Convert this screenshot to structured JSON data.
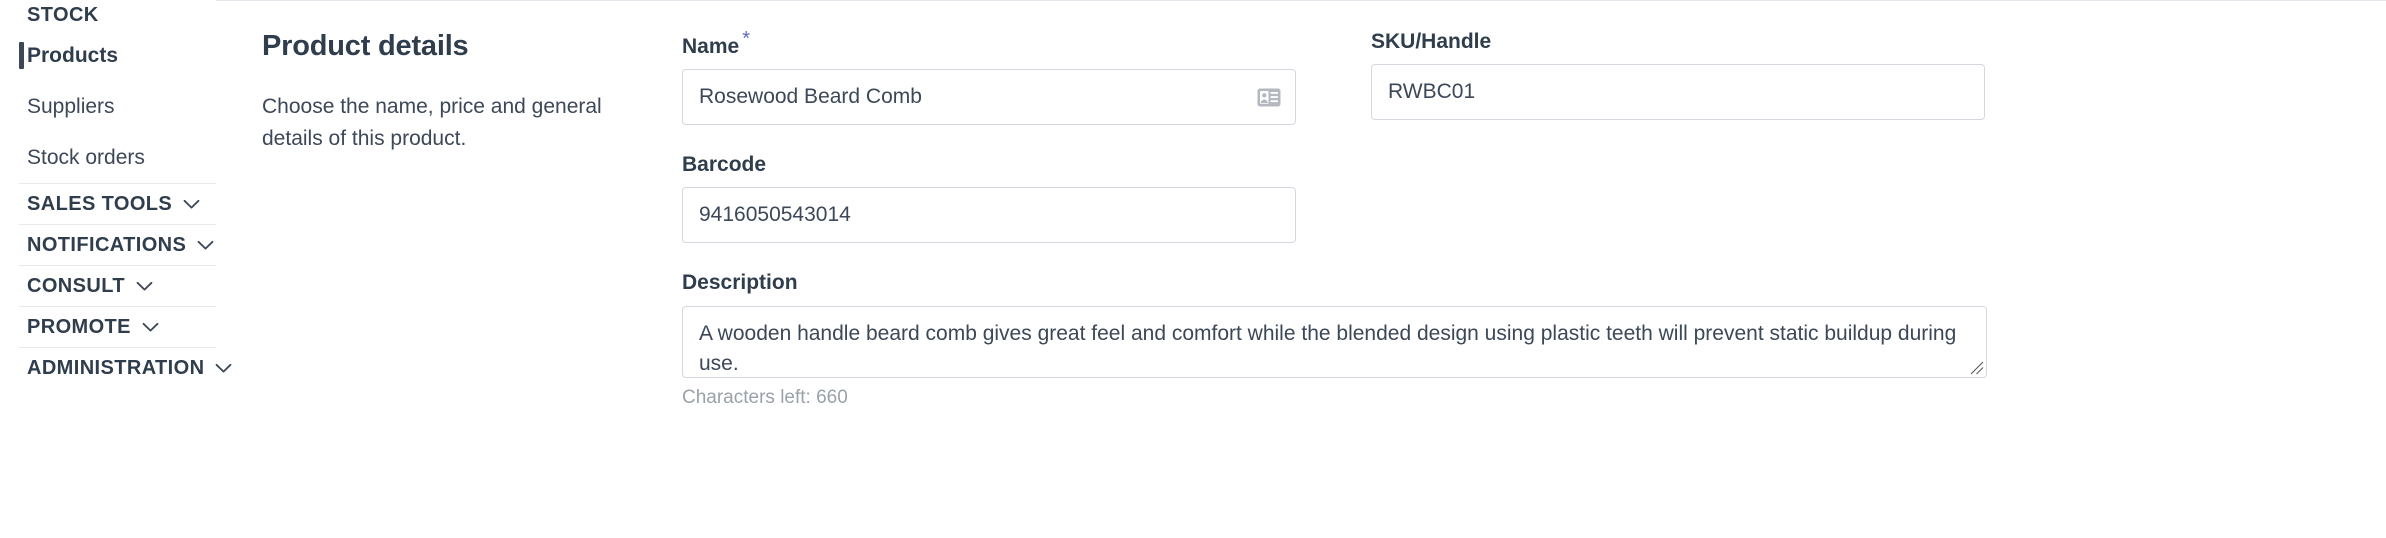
{
  "sidebar": {
    "section_header": "STOCK",
    "items": [
      {
        "label": "Products",
        "active": true
      },
      {
        "label": "Suppliers",
        "active": false
      },
      {
        "label": "Stock orders",
        "active": false
      }
    ],
    "groups": [
      {
        "label": "SALES TOOLS"
      },
      {
        "label": "NOTIFICATIONS"
      },
      {
        "label": "CONSULT"
      },
      {
        "label": "PROMOTE"
      },
      {
        "label": "ADMINISTRATION"
      }
    ]
  },
  "main": {
    "section_title": "Product details",
    "section_description": "Choose the name, price and general details of this product.",
    "fields": {
      "name": {
        "label": "Name",
        "required_marker": "*",
        "value": "Rosewood Beard Comb",
        "icon": "contact-card-icon"
      },
      "sku": {
        "label": "SKU/Handle",
        "value": "RWBC01"
      },
      "barcode": {
        "label": "Barcode",
        "value": "9416050543014"
      },
      "description": {
        "label": "Description",
        "value": "A wooden handle beard comb gives great feel and comfort while the blended design using plastic teeth will prevent static buildup during use.",
        "help_text": "Characters left: 660"
      }
    }
  },
  "colors": {
    "accent_required": "#5c6ac4",
    "text_primary": "#2f3d4c",
    "text_secondary": "#3c4858",
    "text_muted": "#9aa1ab",
    "border": "#d4d8de",
    "divider": "#e8eaee"
  }
}
